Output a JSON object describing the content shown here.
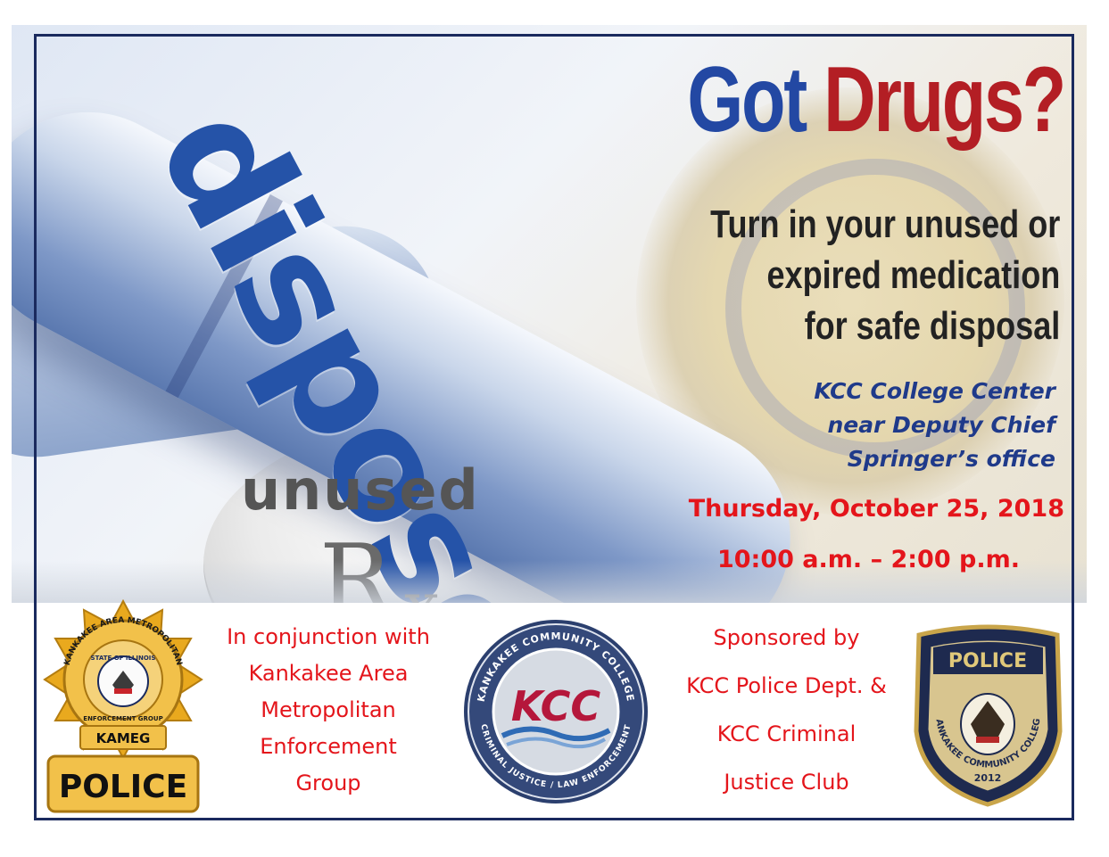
{
  "hero": {
    "capsule_word": "dispose",
    "pill_word": "unused",
    "pill_rx": "R",
    "pill_rx_sub": "x"
  },
  "headline": {
    "part1": "Got",
    "part2": "Drugs?"
  },
  "tagline": {
    "line1": "Turn in your unused or",
    "line2": "expired medication",
    "line3": "for safe disposal"
  },
  "location": {
    "line1": "KCC College Center",
    "line2": "near Deputy Chief",
    "line3": "Springer’s office"
  },
  "event": {
    "date": "Thursday, October 25, 2018",
    "time": "10:00 a.m. – 2:00 p.m."
  },
  "partner": {
    "line1": "In conjunction with",
    "line2": "Kankakee Area",
    "line3": "Metropolitan",
    "line4": "Enforcement",
    "line5": "Group"
  },
  "sponsor": {
    "line1": "Sponsored by",
    "line2": "KCC Police Dept. &",
    "line3": "KCC Criminal",
    "line4": "Justice Club"
  },
  "kameg_badge": {
    "ring_text": "KANKAKEE AREA METROPOLITAN",
    "state_text": "STATE OF ILLINOIS",
    "group_text": "ENFORCEMENT GROUP",
    "acronym": "KAMEG",
    "label": "POLICE"
  },
  "kcc_logo": {
    "top_text": "KANKAKEE COMMUNITY COLLEGE",
    "bottom_text": "CRIMINAL JUSTICE / LAW ENFORCEMENT",
    "center": "KCC"
  },
  "police_patch": {
    "title": "POLICE",
    "arc_text": "KANKAKEE COMMUNITY COLLEGE",
    "year": "2012"
  },
  "colors": {
    "frame": "#1a2a5e",
    "red": "#e4151b",
    "blue": "#2348a3",
    "dark_red": "#b31e24",
    "navy": "#1f3a8a",
    "gold": "#e9a91e"
  }
}
